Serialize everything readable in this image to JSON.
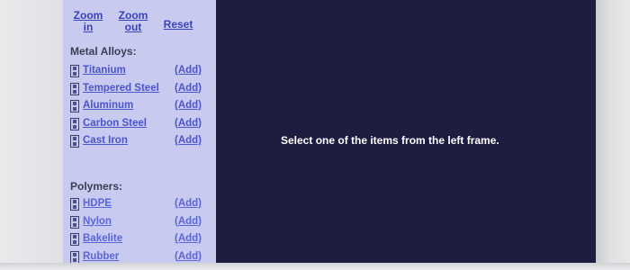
{
  "left_frame": {
    "toolbar": {
      "zoom_in": "Zoom in",
      "zoom_out": "Zoom out",
      "reset": "Reset"
    },
    "sections": [
      {
        "title": "Metal Alloys:",
        "items": [
          {
            "label": "Titanium",
            "add": "(Add)"
          },
          {
            "label": "Tempered Steel",
            "add": "(Add)"
          },
          {
            "label": "Aluminum",
            "add": "(Add)"
          },
          {
            "label": "Carbon Steel",
            "add": "(Add)"
          },
          {
            "label": "Cast Iron",
            "add": "(Add)"
          }
        ]
      },
      {
        "title": "Polymers:",
        "items": [
          {
            "label": "HDPE",
            "add": "(Add)"
          },
          {
            "label": "Nylon",
            "add": "(Add)"
          },
          {
            "label": "Bakelite",
            "add": "(Add)"
          },
          {
            "label": "Rubber",
            "add": "(Add)"
          }
        ]
      }
    ]
  },
  "right_frame": {
    "message": "Select one of the items from the left frame."
  },
  "icons": {
    "item_icon": "item-icon"
  }
}
